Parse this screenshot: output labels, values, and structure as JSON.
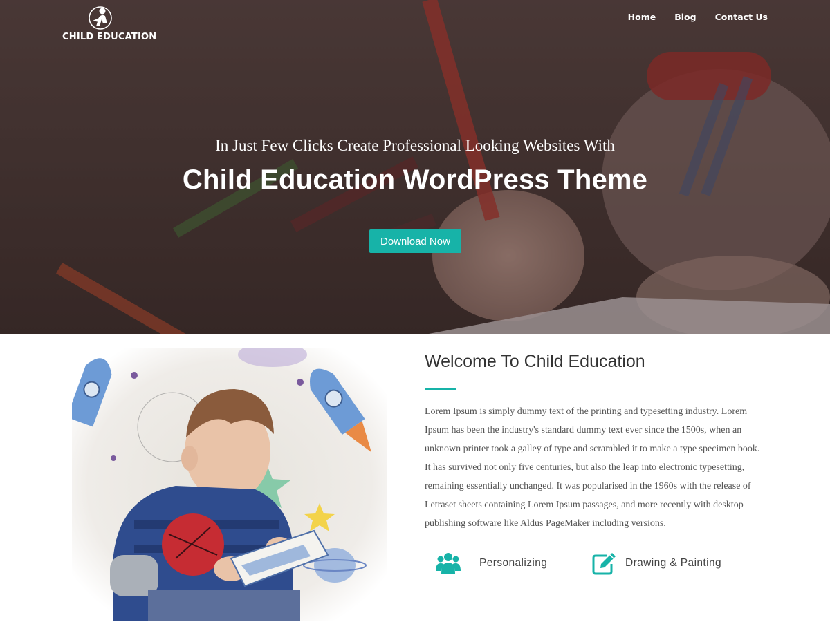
{
  "header": {
    "logo_text": "CHILD EDUCATION",
    "nav": [
      {
        "label": "Home"
      },
      {
        "label": "Blog"
      },
      {
        "label": "Contact Us"
      }
    ]
  },
  "hero": {
    "subtitle": "In Just Few Clicks Create Professional Looking Websites With",
    "title": "Child Education WordPress Theme",
    "button_label": "Download Now"
  },
  "welcome": {
    "title": "Welcome To Child Education",
    "body": "Lorem Ipsum is simply dummy text of the printing and typesetting industry. Lorem Ipsum has been the industry's standard dummy text ever since the 1500s, when an unknown printer took a galley of type and scrambled it to make a type specimen book. It has survived not only five centuries, but also the leap into electronic typesetting, remaining essentially unchanged. It was popularised in the 1960s with the release of Letraset sheets containing Lorem Ipsum passages, and more recently with desktop publishing software like Aldus PageMaker including versions.",
    "features": [
      {
        "label": "Personalizing",
        "icon": "users-icon"
      },
      {
        "label": "Drawing & Painting",
        "icon": "pencil-square-icon"
      }
    ]
  },
  "colors": {
    "accent": "#17b3a8",
    "text_dark": "#333333",
    "text_body": "#555555"
  }
}
